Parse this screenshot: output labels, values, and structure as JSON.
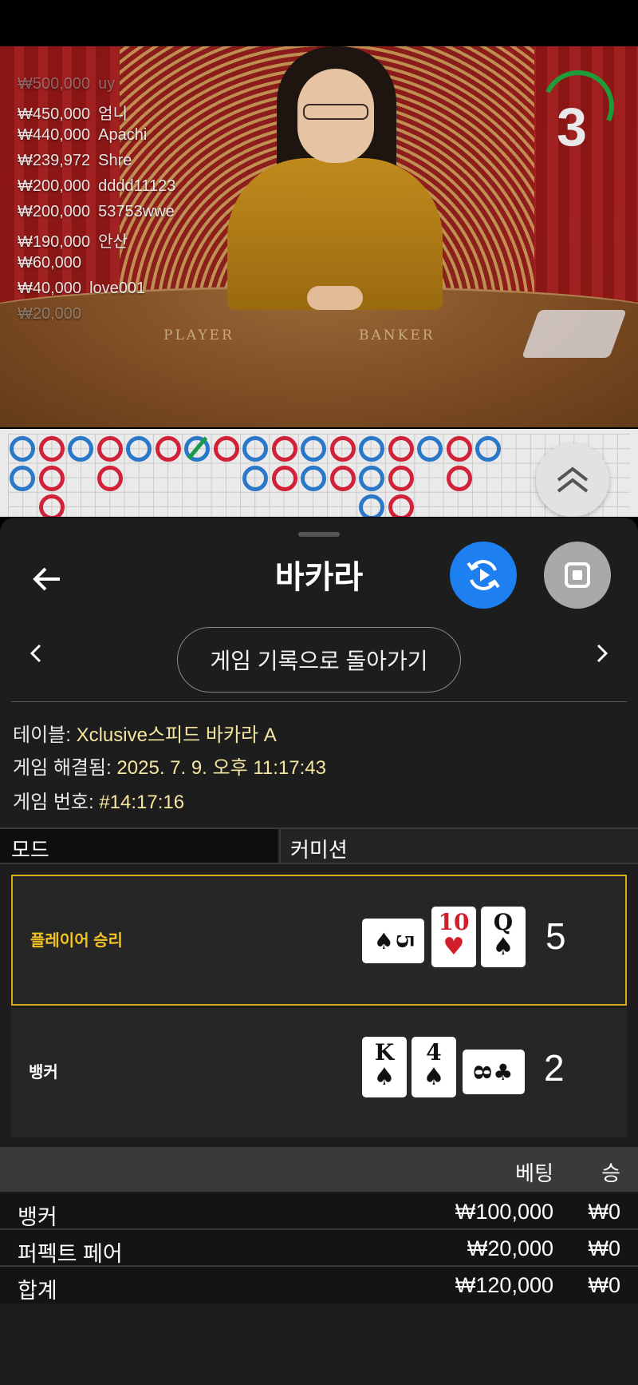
{
  "video": {
    "table_labels": {
      "player": "PLAYER",
      "banker": "BANKER"
    },
    "countdown": "3",
    "winners": [
      {
        "amount": "₩500,000",
        "name": "uy"
      },
      {
        "amount": "₩450,000",
        "name": "엄니"
      },
      {
        "amount": "₩440,000",
        "name": "Apachi"
      },
      {
        "amount": "₩239,972",
        "name": "Shre"
      },
      {
        "amount": "₩200,000",
        "name": "dddd11123"
      },
      {
        "amount": "₩200,000",
        "name": "53753wwe"
      },
      {
        "amount": "₩190,000",
        "name": "안산"
      },
      {
        "amount": "₩60,000",
        "name": ""
      },
      {
        "amount": "₩40,000",
        "name": "love001"
      },
      {
        "amount": "₩20,000",
        "name": ""
      }
    ]
  },
  "roadmap": {
    "colors": {
      "player": "#2b78c8",
      "banker": "#d0233a",
      "tie": "#1a9a4a"
    }
  },
  "header": {
    "title": "바카라",
    "back_icon": "arrow-left-icon",
    "history_icon": "replay-icon",
    "stop_icon": "stop-icon",
    "history_color": "#1d7ff0"
  },
  "nav": {
    "back_to_history": "게임 기록으로 돌아가기",
    "prev_icon": "chevron-left-icon",
    "next_icon": "chevron-right-icon"
  },
  "info": {
    "table_label": "테이블:",
    "table_value": "Xclusive스피드 바카라 A",
    "resolved_label": "게임 해결됨:",
    "resolved_value": "2025. 7. 9. 오후 11:17:43",
    "game_no_label": "게임 번호:",
    "game_no_value": "#14:17:16"
  },
  "mode": {
    "label": "모드",
    "value": "커미션"
  },
  "results": {
    "player": {
      "label": "플레이어 승리",
      "score": "5",
      "cards": [
        {
          "rank": "5",
          "suit": "♠",
          "color": "black",
          "sideways": true
        },
        {
          "rank": "10",
          "suit": "♥",
          "color": "red",
          "sideways": false
        },
        {
          "rank": "Q",
          "suit": "♠",
          "color": "black",
          "sideways": false
        }
      ]
    },
    "banker": {
      "label": "뱅커",
      "score": "2",
      "cards": [
        {
          "rank": "K",
          "suit": "♠",
          "color": "black",
          "sideways": false
        },
        {
          "rank": "4",
          "suit": "♠",
          "color": "black",
          "sideways": false
        },
        {
          "rank": "8",
          "suit": "♣",
          "color": "black",
          "sideways": true
        }
      ]
    },
    "win_color": "#d4ad1f"
  },
  "bets": {
    "headers": {
      "bet": "베팅",
      "win": "승"
    },
    "rows": [
      {
        "name": "뱅커",
        "bet": "₩100,000",
        "win": "₩0"
      },
      {
        "name": "퍼펙트 페어",
        "bet": "₩20,000",
        "win": "₩0"
      },
      {
        "name": "합계",
        "bet": "₩120,000",
        "win": "₩0"
      }
    ]
  }
}
